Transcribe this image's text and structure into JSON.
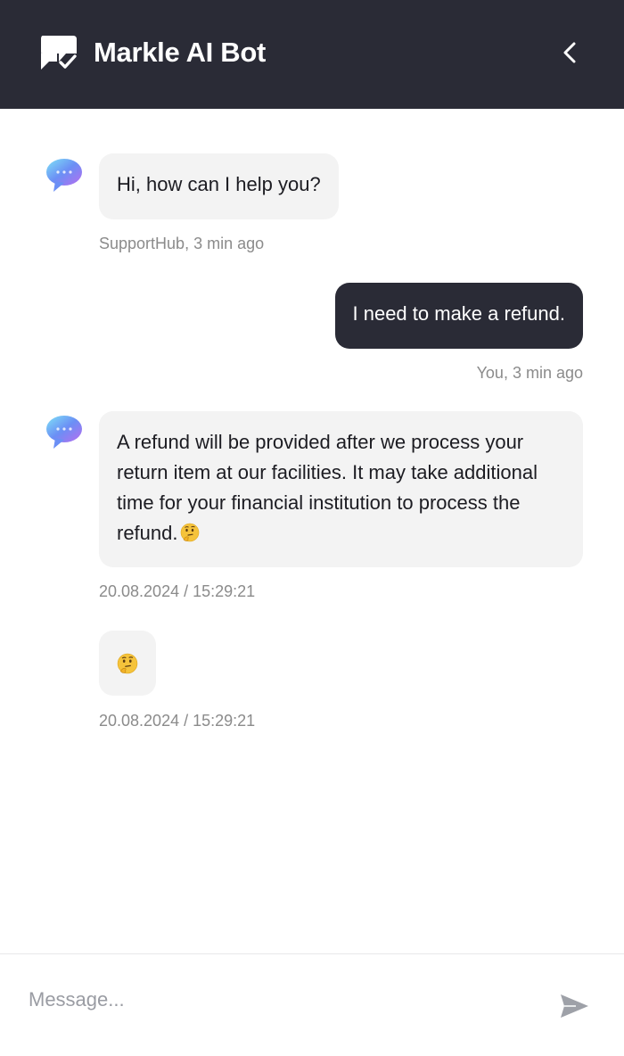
{
  "header": {
    "title": "Markle AI Bot",
    "logo_icon": "chat-check-icon",
    "back_icon": "chevron-left-icon",
    "background": "#2a2b36"
  },
  "messages": [
    {
      "sender": "bot",
      "text": "Hi, how can I help you?",
      "meta": "SupportHub, 3 min ago"
    },
    {
      "sender": "user",
      "text": "I need to make a refund.",
      "meta": "You, 3 min ago"
    },
    {
      "sender": "bot",
      "text": "A refund will be provided after we process your return item at our facilities. It may take additional time for your financial institution to process the refund.",
      "emoji": "thinking-face",
      "meta": "20.08.2024 / 15:29:21"
    },
    {
      "sender": "bot",
      "emoji": "thinking-face",
      "meta": "20.08.2024 / 15:29:21"
    }
  ],
  "composer": {
    "placeholder": "Message...",
    "send_icon": "send-icon"
  },
  "colors": {
    "bubble_bot": "#f3f3f3",
    "bubble_user": "#2a2b36",
    "meta_text": "#8b8b8b"
  }
}
